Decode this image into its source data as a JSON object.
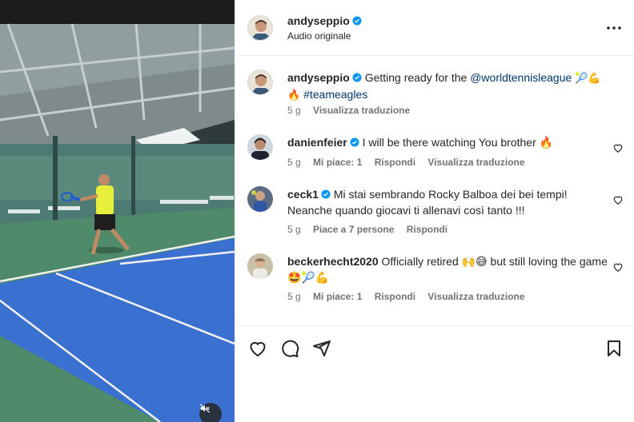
{
  "post": {
    "author": "andyseppio",
    "subtitle": "Audio originale",
    "caption": {
      "username": "andyseppio",
      "text_before": "Getting ready for the",
      "mention": "@worldtennisleague",
      "emojis_1": "🎾💪",
      "emojis_2": "🔥",
      "hashtag": "#teameagles",
      "time": "5 g",
      "translate": "Visualizza traduzione"
    }
  },
  "comments": [
    {
      "username": "danienfeier",
      "text": "I will be there watching You brother 🔥",
      "time": "5 g",
      "likes": "Mi piace: 1",
      "reply": "Rispondi",
      "translate": "Visualizza traduzione"
    },
    {
      "username": "ceck1",
      "text": "Mi stai sembrando Rocky Balboa dei bei tempi! Neanche quando giocavi ti allenavi così tanto !!!",
      "time": "5 g",
      "likes": "Piace a 7 persone",
      "reply": "Rispondi"
    },
    {
      "username": "beckerhecht2020",
      "text": "Officially retired 🙌😅 but still loving the game 🤩🎾💪",
      "time": "5 g",
      "likes": "Mi piace: 1",
      "reply": "Rispondi",
      "translate": "Visualizza traduzione"
    }
  ],
  "actions": {
    "like": "heart-icon",
    "comment": "comment-icon",
    "share": "share-icon",
    "save": "bookmark-icon"
  },
  "colors": {
    "verified": "#0095f6",
    "link": "#00376b",
    "meta": "#737373",
    "court_blue": "#3a70d0",
    "court_green": "#4f8a6a"
  }
}
